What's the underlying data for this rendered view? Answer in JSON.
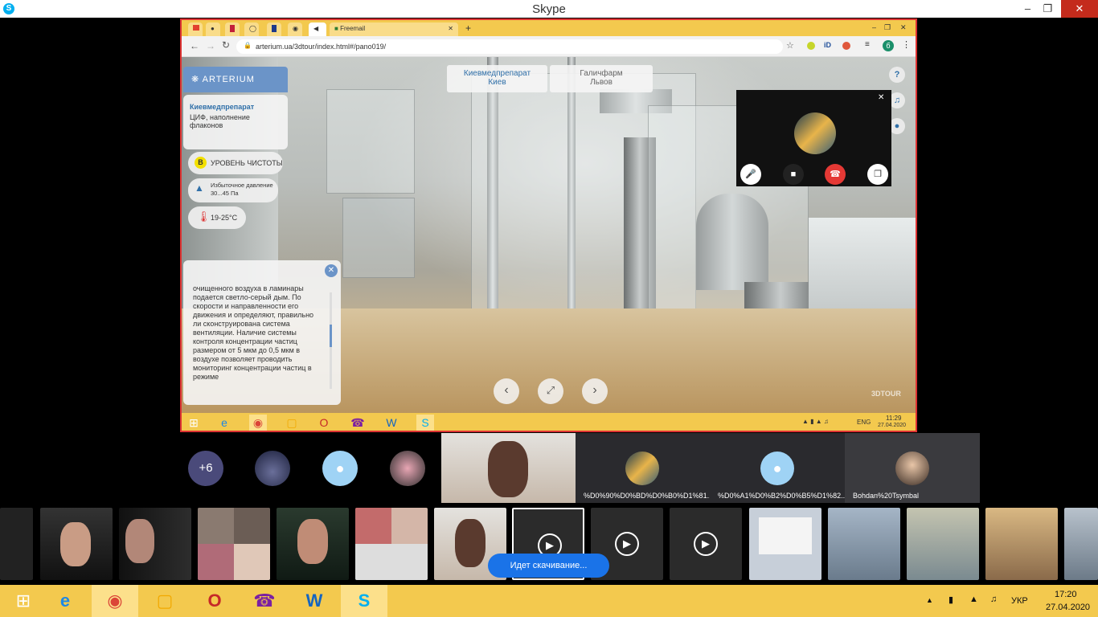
{
  "window": {
    "title": "Skype",
    "minimize": "–",
    "maximize": "❐",
    "close": "✕"
  },
  "browser": {
    "tabs": [
      {
        "label": "Freemail"
      }
    ],
    "new_tab": "+",
    "tab_close": "✕",
    "url": "arterium.ua/3dtour/index.html#/pano019/",
    "profile_initial": "б"
  },
  "tour": {
    "brand": "ARTERIUM",
    "sites": [
      {
        "line1": "Киевмедпрепарат",
        "line2": "Киев"
      },
      {
        "line1": "Галичфарм",
        "line2": "Львов"
      }
    ],
    "location": {
      "title": "Киевмедпрепарат",
      "subtitle": "ЦИФ, наполнение флаконов"
    },
    "cleanliness": {
      "badge": "B",
      "label": "УРОВЕНЬ ЧИСТОТЫ"
    },
    "pressure": {
      "label": "Избыточное давление 30...45 Па"
    },
    "temperature": {
      "label": "19-25°C"
    },
    "description": "очищенного воздуха в ламинары подается светло-серый дым. По скорости и направленности его движения и определяют, правильно ли сконструирована система вентиляции. Наличие системы контроля концентрации частиц размером от 5 мкм до 0,5 мкм в воздухе позволяет проводить мониторинг концентрации частиц в режиме",
    "watermark": "3DTOUR",
    "help": "?"
  },
  "inner_taskbar": {
    "lang": "ENG",
    "time": "11:29",
    "date": "27.04.2020"
  },
  "participants": {
    "overflow": "+6",
    "tiles": [
      {
        "label": "%D0%90%D0%BD%D0%B0%D1%81..."
      },
      {
        "label": "%D0%A1%D0%B2%D0%B5%D1%82..."
      },
      {
        "label": "Bohdan%20Tsymbal"
      }
    ]
  },
  "download_toast": "Идет скачивание...",
  "taskbar": {
    "lang": "УКР",
    "time": "17:20",
    "date": "27.04.2020"
  },
  "colors": {
    "accent": "#d33030",
    "taskbar": "#f3c94e",
    "skype": "#00aff0",
    "hangup": "#e53935",
    "toast": "#1a73e8"
  }
}
